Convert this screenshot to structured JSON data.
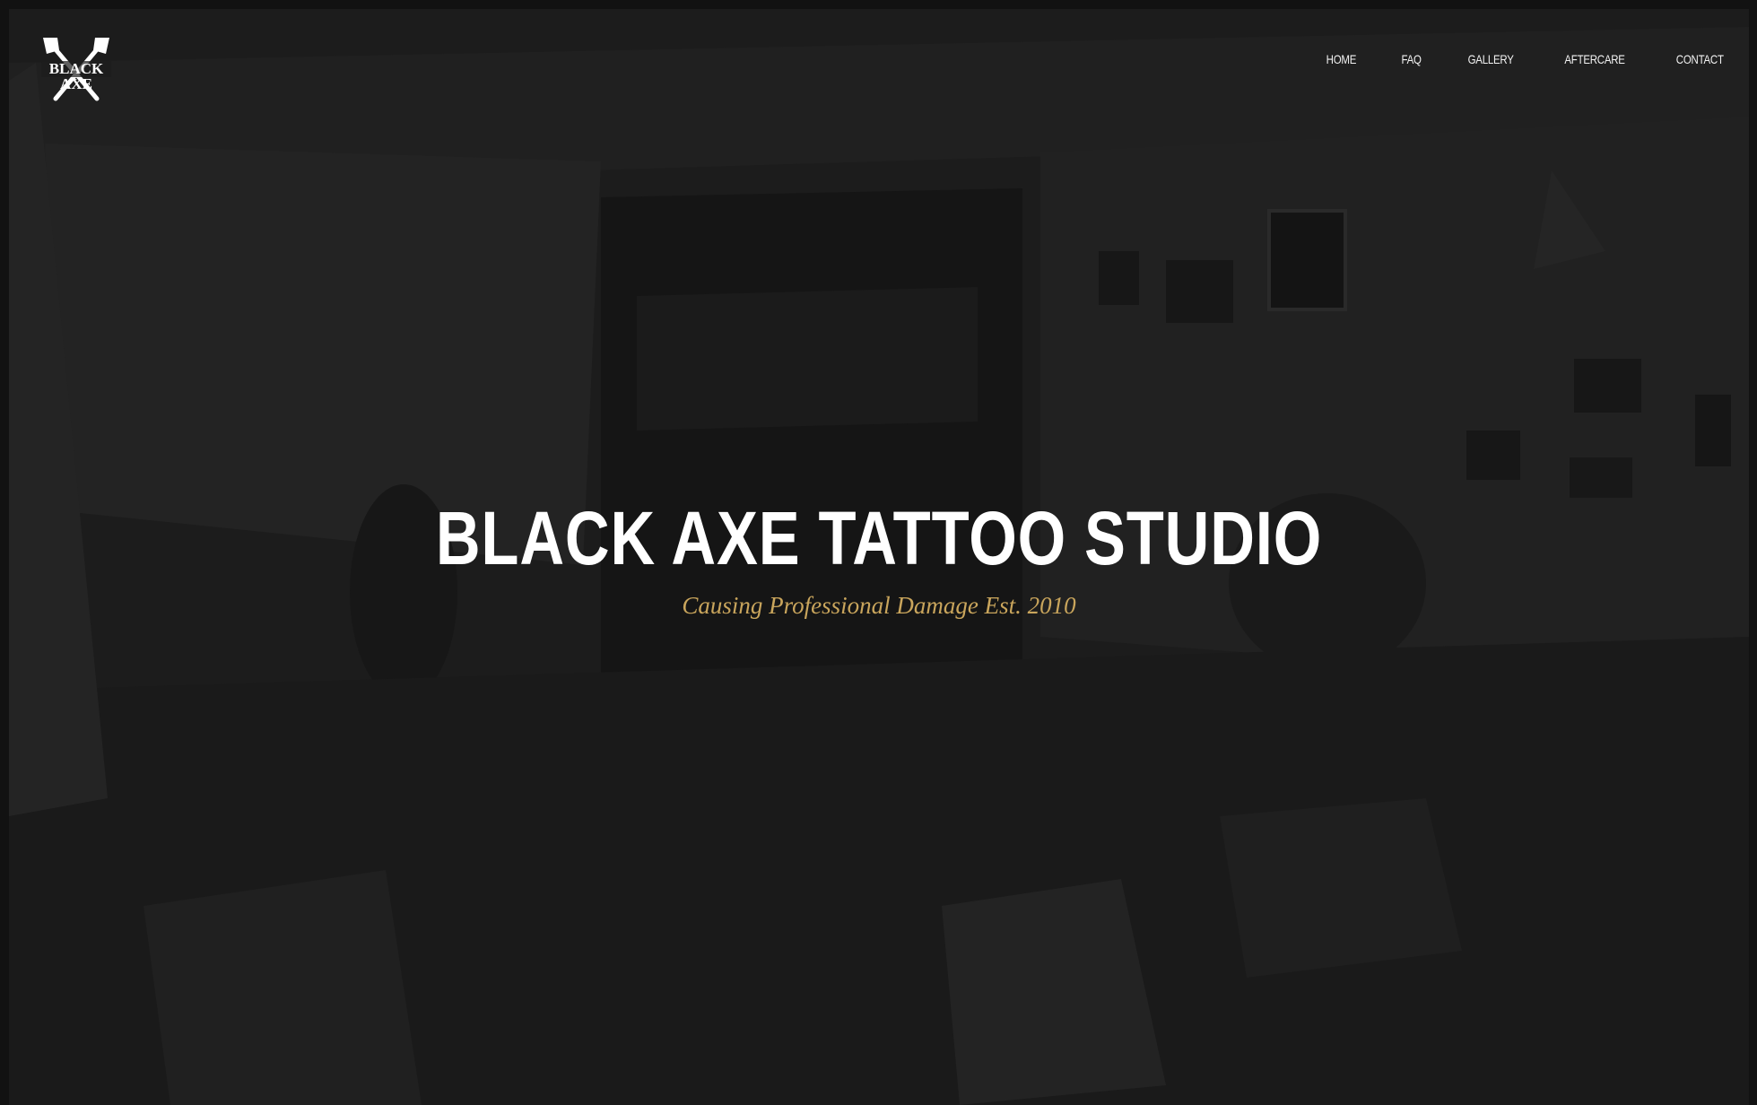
{
  "logo": {
    "line1": "BLACK",
    "line2": "AXE",
    "icon": "crossed-axes-icon"
  },
  "nav": {
    "items": [
      "HOME",
      "FAQ",
      "GALLERY",
      "AFTERCARE",
      "CONTACT"
    ]
  },
  "hero": {
    "title": "BLACK AXE TATTOO STUDIO",
    "subtitle": "Causing Professional Damage Est. 2010"
  },
  "colors": {
    "background": "#1d1d1d",
    "accent": "#c9a55c",
    "text": "#ffffff"
  }
}
